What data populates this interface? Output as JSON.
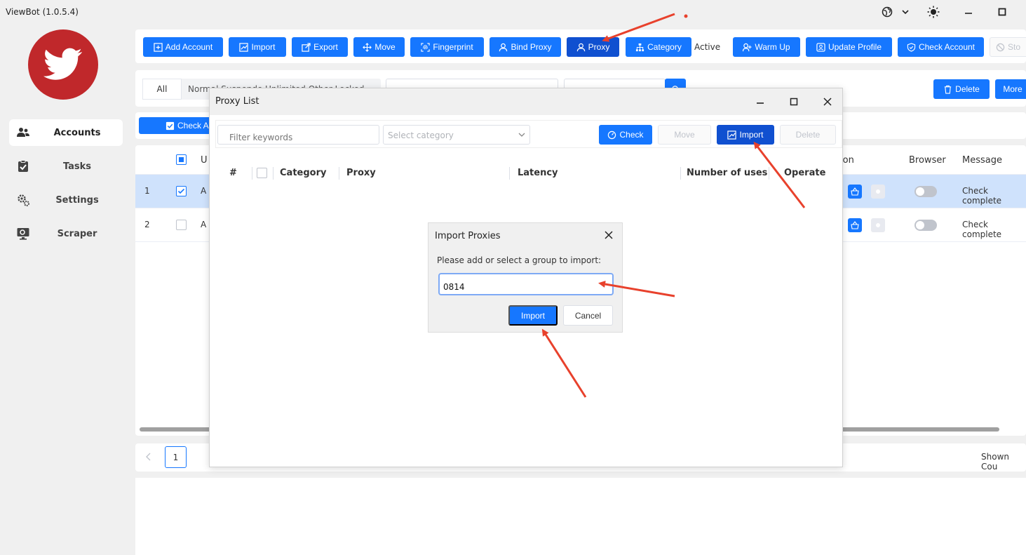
{
  "window": {
    "title": "ViewBot (1.0.5.4)"
  },
  "sidebar": {
    "items": [
      {
        "label": "Accounts",
        "active": true
      },
      {
        "label": "Tasks"
      },
      {
        "label": "Settings"
      },
      {
        "label": "Scraper"
      }
    ]
  },
  "toolbar": {
    "add_account": "Add Account",
    "import": "Import",
    "export": "Export",
    "move": "Move",
    "fingerprint": "Fingerprint",
    "bind_proxy": "Bind Proxy",
    "proxy": "Proxy",
    "category": "Category",
    "active_label": "Active",
    "warm_up": "Warm Up",
    "update_profile": "Update Profile",
    "check_account": "Check Account",
    "stop_partial": "Sto"
  },
  "filters": {
    "seg_all": "All",
    "seg_rest": "Normal  Suspende  Unlimited  Other  Locked",
    "delete": "Delete",
    "more": "More"
  },
  "actionbar": {
    "check_partial": "Check A"
  },
  "table": {
    "headers": {
      "u_partial": "U",
      "ion_partial": "ion",
      "browser": "Browser",
      "message": "Message"
    },
    "rows": [
      {
        "index": "1",
        "name_partial": "A",
        "message": "Check complete",
        "selected": true
      },
      {
        "index": "2",
        "name_partial": "A",
        "message": "Check complete",
        "selected": false
      }
    ]
  },
  "pager": {
    "page": "1",
    "shown_partial": "Shown Cou"
  },
  "proxy_window": {
    "title": "Proxy List",
    "filter_placeholder": "Filter keywords",
    "category_placeholder": "Select category",
    "check": "Check",
    "move": "Move",
    "import": "Import",
    "delete": "Delete",
    "columns": {
      "index": "#",
      "category": "Category",
      "proxy": "Proxy",
      "latency": "Latency",
      "uses": "Number of uses",
      "operate": "Operate"
    }
  },
  "import_dialog": {
    "title": "Import Proxies",
    "message": "Please add or select a group to import:",
    "group_value": "0814",
    "import": "Import",
    "cancel": "Cancel"
  },
  "colors": {
    "primary": "#1677ff",
    "primary_dark": "#1050d0",
    "logo": "#c0282b",
    "annotation": "#e8412c"
  }
}
